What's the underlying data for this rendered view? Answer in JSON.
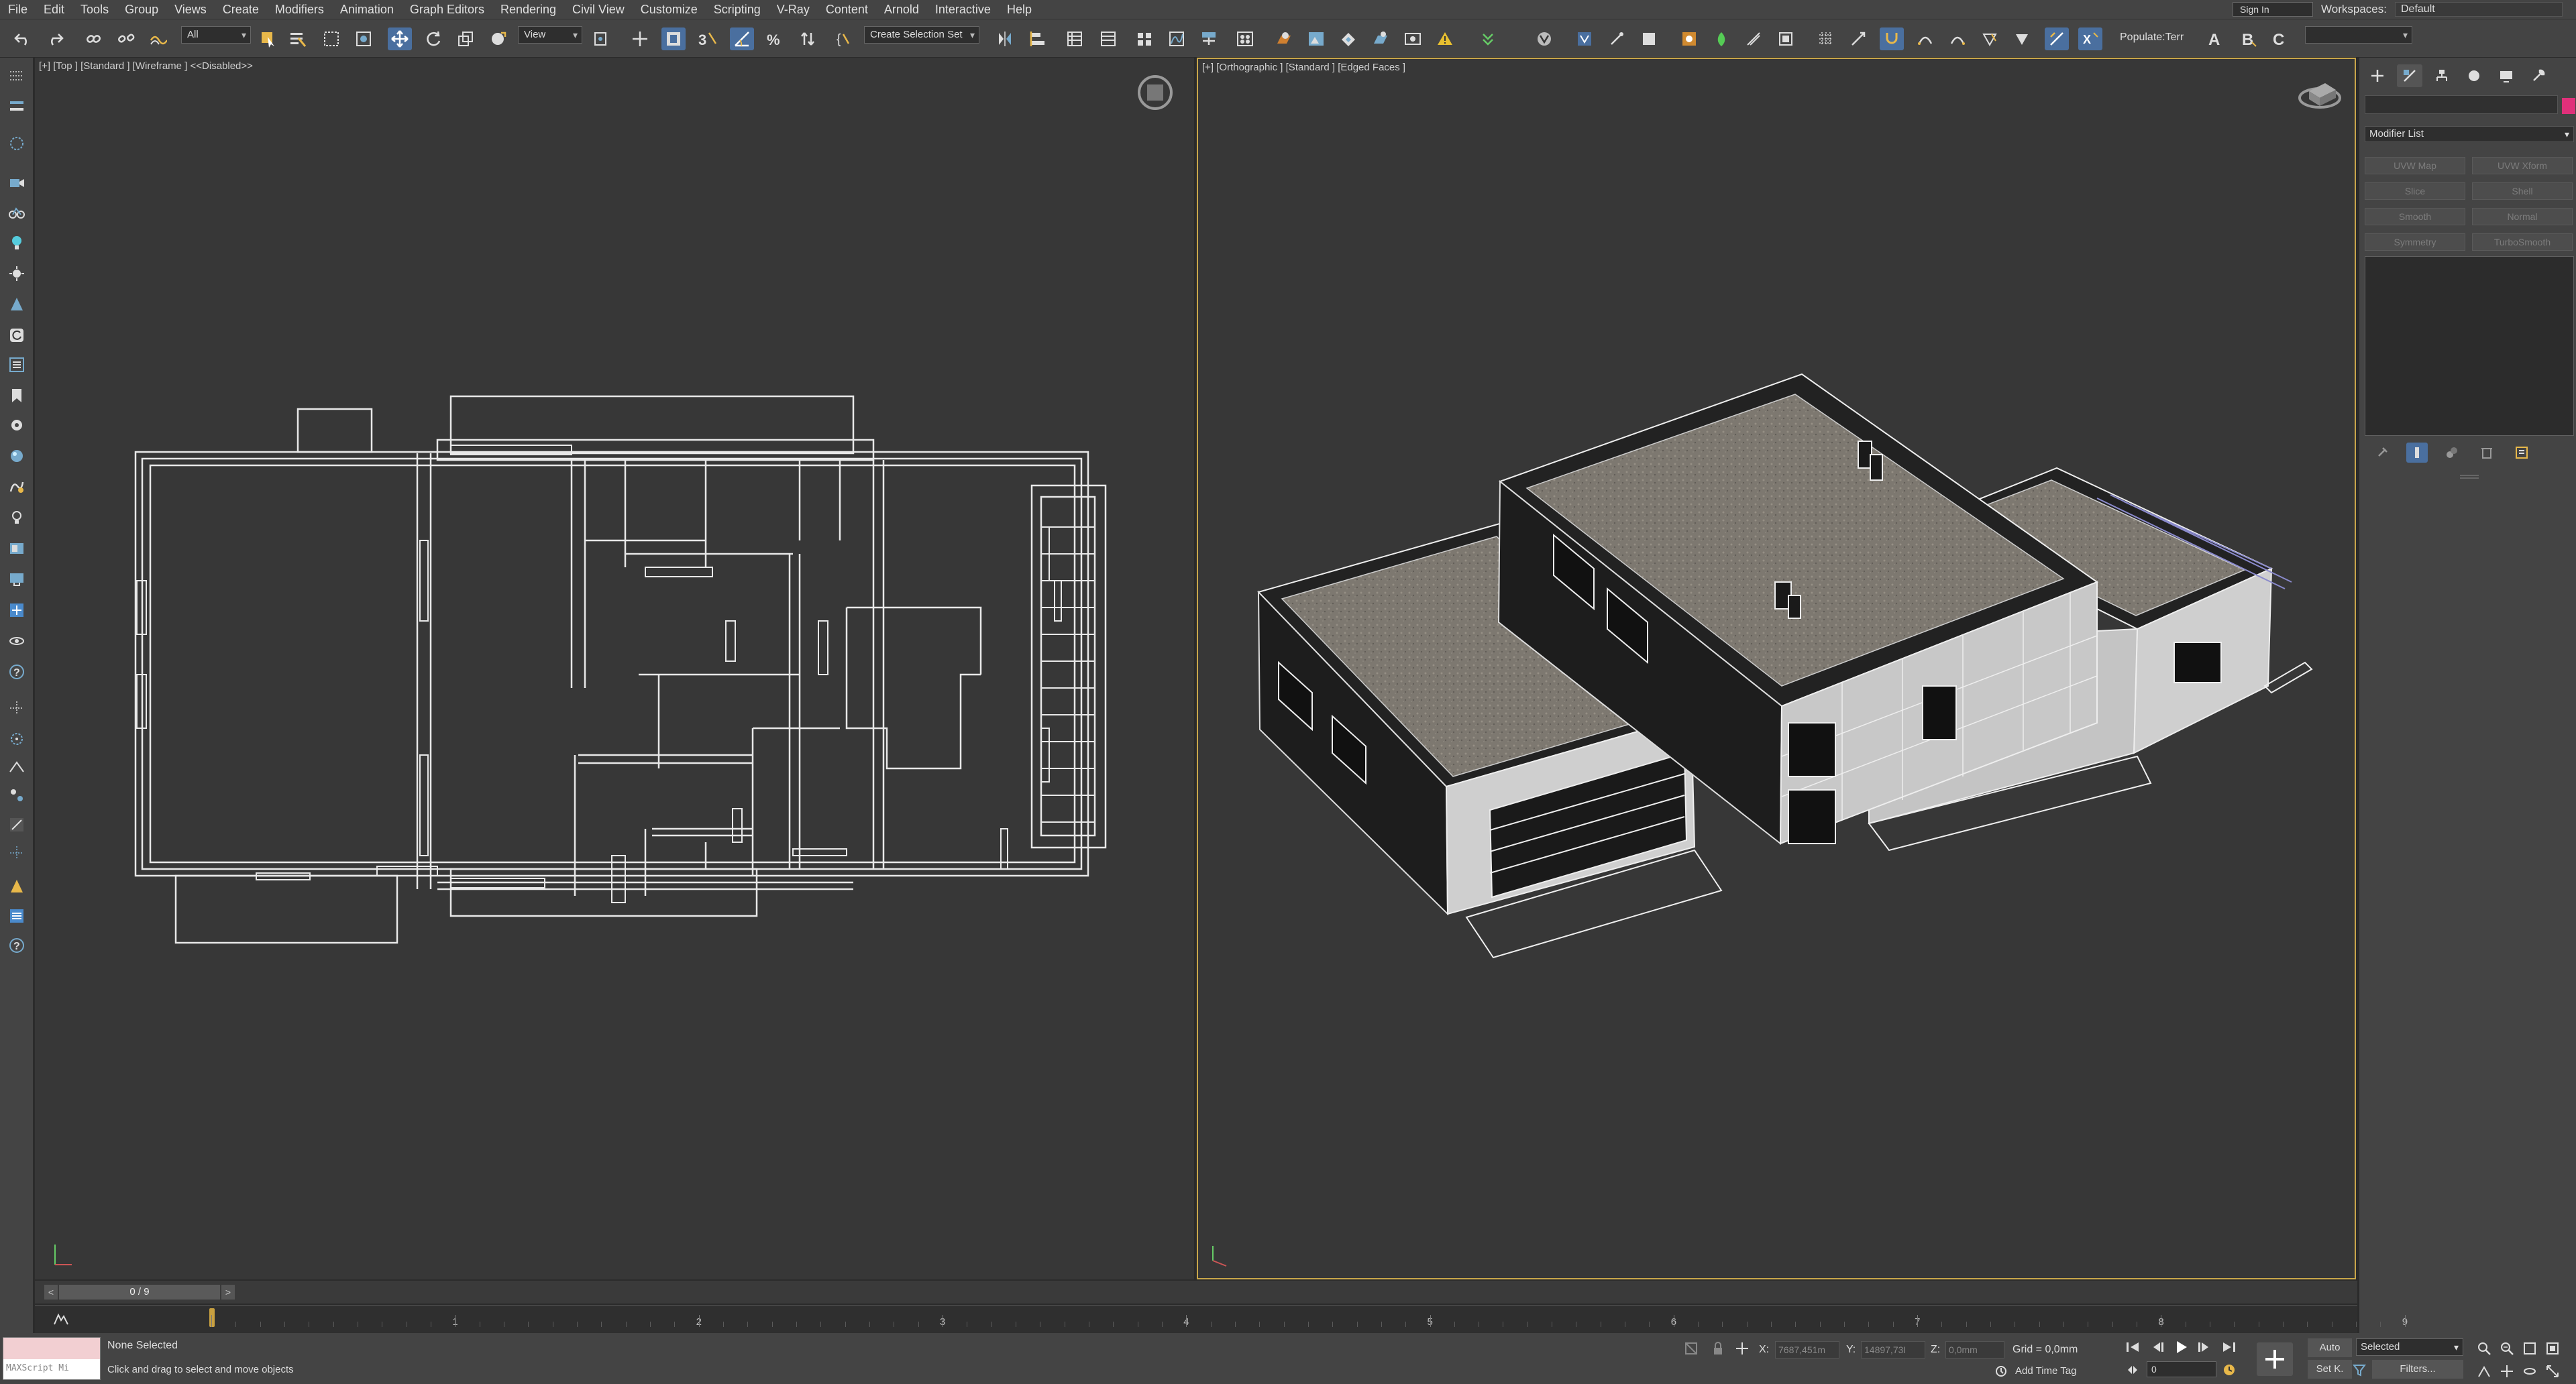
{
  "menu": [
    "File",
    "Edit",
    "Tools",
    "Group",
    "Views",
    "Create",
    "Modifiers",
    "Animation",
    "Graph Editors",
    "Rendering",
    "Civil View",
    "Customize",
    "Scripting",
    "V-Ray",
    "Content",
    "Arnold",
    "Interactive",
    "Help"
  ],
  "signin": "Sign In",
  "workspaces_label": "Workspaces:",
  "workspace_value": "Default",
  "toolbar": {
    "filter_all": "All",
    "ref_coord": "View",
    "selection_set": "Create Selection Set",
    "populate": "Populate:Terr"
  },
  "viewports": {
    "left_label": "[+] [Top ] [Standard ] [Wireframe ]  <<Disabled>>",
    "right_label": "[+] [Orthographic ] [Standard ] [Edged Faces ]"
  },
  "command_panel": {
    "modifier_list": "Modifier List",
    "buttons": [
      "UVW Map",
      "UVW Xform",
      "Slice",
      "Shell",
      "Smooth",
      "Normal",
      "Symmetry",
      "TurboSmooth"
    ]
  },
  "timeslider": {
    "frame": "0 / 9",
    "prev": "<",
    "next": ">"
  },
  "trackbar": {
    "ticks": [
      "1",
      "2",
      "3",
      "4",
      "5",
      "6",
      "7",
      "8",
      "9"
    ]
  },
  "status": {
    "maxscript": "MAXScript Mi",
    "selection": "None Selected",
    "prompt": "Click and drag to select and move objects",
    "x_label": "X:",
    "x_value": "7687,451m",
    "y_label": "Y:",
    "y_value": "14897,73I",
    "z_label": "Z:",
    "z_value": "0,0mm",
    "grid": "Grid = 0,0mm",
    "add_time_tag": "Add Time Tag",
    "auto": "Auto",
    "set_key": "Set K.",
    "key_filter": "Selected",
    "filters": "Filters...",
    "current_frame": "0"
  },
  "colors": {
    "accent": "#4a6f9f",
    "viewport_border": "#c9a64a",
    "object_color": "#e0307a"
  }
}
